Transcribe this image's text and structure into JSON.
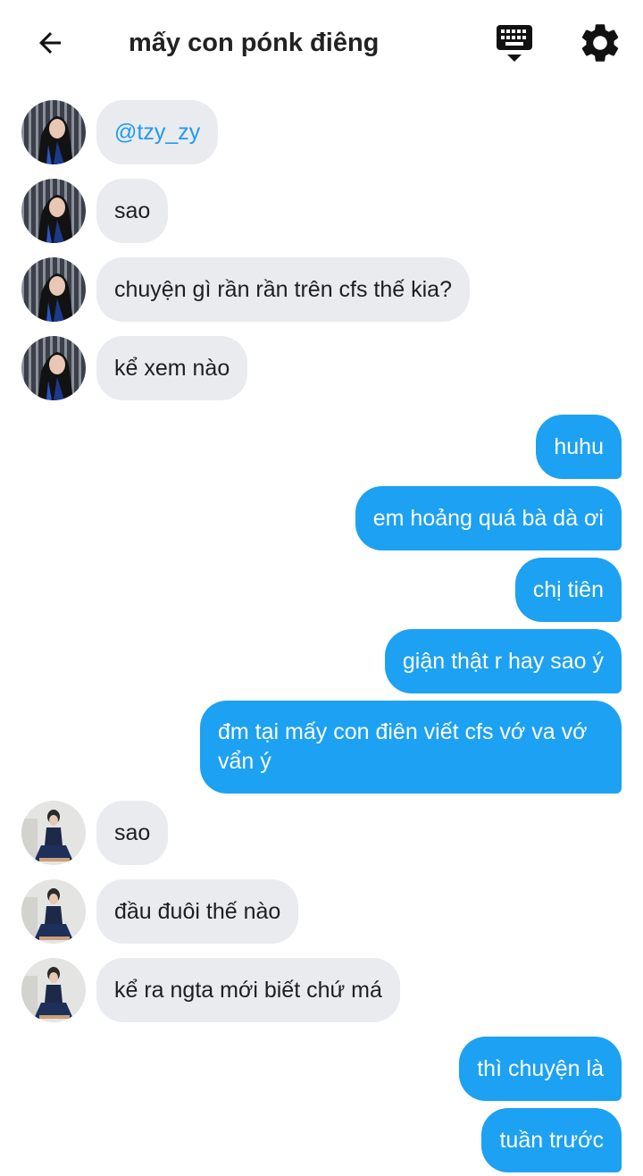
{
  "header": {
    "title": "mấy con pónk điêng",
    "back_icon": "arrow-left-icon",
    "keyboard_icon": "keyboard-hide-icon",
    "settings_icon": "gear-icon"
  },
  "colors": {
    "outgoing_bubble": "#1da1f2",
    "incoming_bubble": "#e9ebee",
    "mention": "#1d9bf0"
  },
  "messages": [
    {
      "sender": "user_a",
      "direction": "incoming",
      "text": "@tzy_zy",
      "is_mention": true
    },
    {
      "sender": "user_a",
      "direction": "incoming",
      "text": "sao"
    },
    {
      "sender": "user_a",
      "direction": "incoming",
      "text": "chuyện gì rần rần trên cfs thế kia?"
    },
    {
      "sender": "user_a",
      "direction": "incoming",
      "text": "kể xem nào"
    },
    {
      "sender": "me",
      "direction": "outgoing",
      "text": "huhu"
    },
    {
      "sender": "me",
      "direction": "outgoing",
      "text": "em hoảng quá bà dà ơi"
    },
    {
      "sender": "me",
      "direction": "outgoing",
      "text": "chị tiên"
    },
    {
      "sender": "me",
      "direction": "outgoing",
      "text": "giận thật r hay sao ý"
    },
    {
      "sender": "me",
      "direction": "outgoing",
      "text": "đm tại mấy con điên viết cfs vớ va vớ vẩn ý"
    },
    {
      "sender": "user_b",
      "direction": "incoming",
      "text": "sao"
    },
    {
      "sender": "user_b",
      "direction": "incoming",
      "text": "đầu đuôi thế nào"
    },
    {
      "sender": "user_b",
      "direction": "incoming",
      "text": "kể ra ngta mới biết chứ má"
    },
    {
      "sender": "me",
      "direction": "outgoing",
      "text": "thì chuyện là"
    },
    {
      "sender": "me",
      "direction": "outgoing",
      "text": "tuần trước"
    }
  ]
}
